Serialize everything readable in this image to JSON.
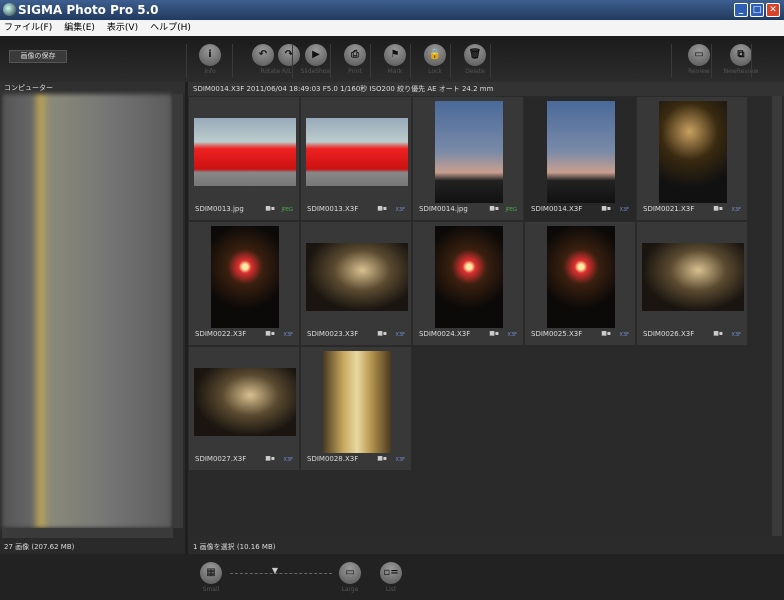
{
  "window": {
    "title": "SIGMA Photo Pro 5.0"
  },
  "menu": [
    "ファイル(F)",
    "編集(E)",
    "表示(V)",
    "ヘルプ(H)"
  ],
  "toolbar": {
    "save": "画像の保存",
    "buttons": [
      {
        "label": "Info",
        "glyph": "i"
      },
      {
        "label": "Rotate R/L",
        "glyph": "↶↷"
      },
      {
        "label": "SlideShow",
        "glyph": "▶"
      },
      {
        "label": "Print",
        "glyph": "⎙"
      },
      {
        "label": "Mark",
        "glyph": "⚑"
      },
      {
        "label": "Lock",
        "glyph": "🔒"
      },
      {
        "label": "Delete",
        "glyph": "🗑"
      },
      {
        "label": "Review",
        "glyph": "▭"
      },
      {
        "label": "NewReview",
        "glyph": "⧉"
      }
    ]
  },
  "left": {
    "header": "コンピューター",
    "status": "27 画像 (207.62 MB)"
  },
  "main": {
    "info": "SDIM0014.X3F 2011/06/04 18:49:03 F5.0 1/160秒 ISO200 絞り優先 AE オート 24.2 mm",
    "status": "1 画像を選択 (10.16 MB)",
    "items": [
      {
        "name": "SDIM0013.jpg",
        "type": "JPEG",
        "kind": "car"
      },
      {
        "name": "SDIM0013.X3F",
        "type": "X3F",
        "kind": "car"
      },
      {
        "name": "SDIM0014.jpg",
        "type": "JPEG",
        "kind": "dusk"
      },
      {
        "name": "SDIM0014.X3F",
        "type": "X3F",
        "kind": "dusk",
        "selected": true
      },
      {
        "name": "SDIM0021.X3F",
        "type": "X3F",
        "kind": "lampP"
      },
      {
        "name": "SDIM0022.X3F",
        "type": "X3F",
        "kind": "candleP"
      },
      {
        "name": "SDIM0023.X3F",
        "type": "X3F",
        "kind": "lampL"
      },
      {
        "name": "SDIM0024.X3F",
        "type": "X3F",
        "kind": "candleP"
      },
      {
        "name": "SDIM0025.X3F",
        "type": "X3F",
        "kind": "candleP"
      },
      {
        "name": "SDIM0026.X3F",
        "type": "X3F",
        "kind": "lampL"
      },
      {
        "name": "SDIM0027.X3F",
        "type": "X3F",
        "kind": "lampL"
      },
      {
        "name": "SDIM0028.X3F",
        "type": "X3F",
        "kind": "bottle"
      }
    ]
  },
  "bottom": {
    "small": "Small",
    "large": "Large",
    "list": "List",
    "thumb_size": 0.45
  },
  "colors": {
    "jpeg": "#4caf50",
    "x3f": "#6f8fd0"
  }
}
